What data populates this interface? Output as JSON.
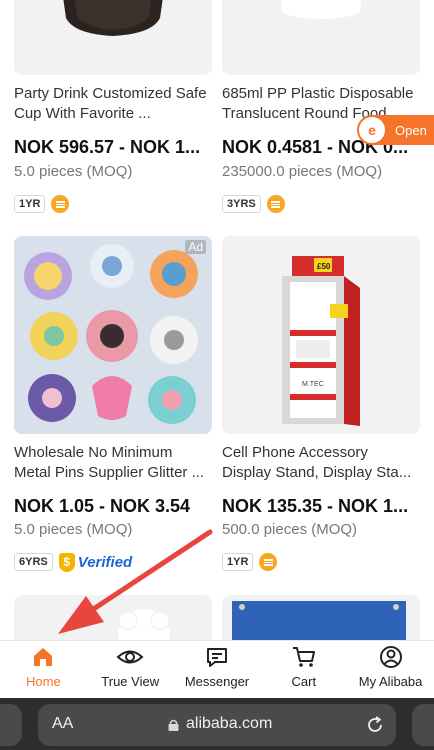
{
  "products": [
    {
      "title1": "Party Drink Customized Safe",
      "title2": "Cup With Favorite ...",
      "price": "NOK 596.57 - NOK 1...",
      "moq": "5.0 pieces (MOQ)",
      "years": "1YR",
      "verified": false,
      "ad": ""
    },
    {
      "title1": "685ml PP Plastic Disposable",
      "title2": "Translucent Round Food",
      "price": "NOK 0.4581 - NOK 0...",
      "moq": "235000.0 pieces (MOQ)",
      "years": "3YRS",
      "verified": false,
      "ad": ""
    },
    {
      "title1": "Wholesale No Minimum",
      "title2": "Metal Pins Supplier Glitter ...",
      "price": "NOK 1.05 - NOK 3.54",
      "moq": "5.0 pieces (MOQ)",
      "years": "6YRS",
      "verified": true,
      "verified_label": "Verified",
      "ad": "Ad"
    },
    {
      "title1": "Cell Phone Accessory",
      "title2": "Display Stand, Display Sta...",
      "price": "NOK 135.35 - NOK 1...",
      "moq": "500.0 pieces (MOQ)",
      "years": "1YR",
      "verified": false,
      "ad": ""
    }
  ],
  "open_button": {
    "label": "Open",
    "logo_glyph": "e"
  },
  "display_stand": {
    "top_label": "£50",
    "brand_text": "M.TEC"
  },
  "tabs": [
    {
      "label": "Home",
      "icon": "home-icon",
      "active": true
    },
    {
      "label": "True View",
      "icon": "eye-icon",
      "active": false
    },
    {
      "label": "Messenger",
      "icon": "message-icon",
      "active": false
    },
    {
      "label": "Cart",
      "icon": "cart-icon",
      "active": false
    },
    {
      "label": "My Alibaba",
      "icon": "user-icon",
      "active": false
    }
  ],
  "browser": {
    "text_size_label": "AA",
    "domain": "alibaba.com"
  },
  "colors": {
    "accent": "#f5742a",
    "verified": "#1a66d9",
    "annotation_arrow": "#e8453c"
  }
}
